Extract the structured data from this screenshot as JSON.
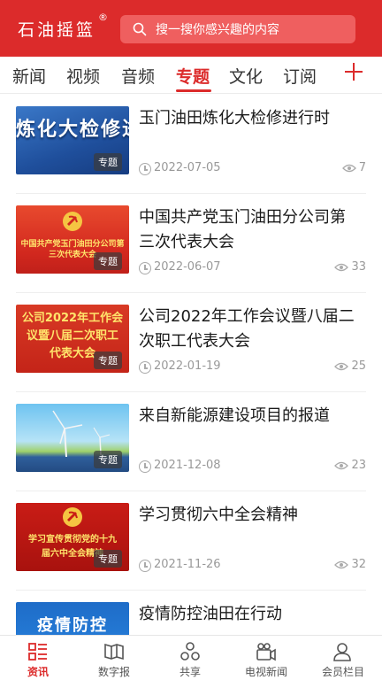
{
  "header": {
    "brand": "石油摇篮",
    "brand_mark": "®",
    "search_placeholder": "搜一搜你感兴趣的内容"
  },
  "tabs": [
    {
      "label": "新闻",
      "active": false
    },
    {
      "label": "视频",
      "active": false
    },
    {
      "label": "音频",
      "active": false
    },
    {
      "label": "专题",
      "active": true
    },
    {
      "label": "文化",
      "active": false
    },
    {
      "label": "订阅",
      "active": false
    }
  ],
  "list": [
    {
      "title": "玉门油田炼化大检修进行时",
      "date": "2022-07-05",
      "views": "7",
      "badge": "专题",
      "thumb_text": "炼化大检修进行时"
    },
    {
      "title": "中国共产党玉门油田分公司第三次代表大会",
      "date": "2022-06-07",
      "views": "33",
      "badge": "专题",
      "thumb_text": "中国共产党玉门油田分公司第三次代表大会"
    },
    {
      "title": "公司2022年工作会议暨八届二次职工代表大会",
      "date": "2022-01-19",
      "views": "25",
      "badge": "专题",
      "thumb_text": "公司2022年工作会议暨八届二次职工代表大会"
    },
    {
      "title": "来自新能源建设项目的报道",
      "date": "2021-12-08",
      "views": "23",
      "badge": "专题"
    },
    {
      "title": "学习贯彻六中全会精神",
      "date": "2021-11-26",
      "views": "32",
      "badge": "专题",
      "thumb_text": "学习宣传贯彻党的十九届六中全会精神"
    },
    {
      "title": "疫情防控油田在行动",
      "thumb_text": "疫情防控"
    }
  ],
  "bottom_nav": [
    {
      "label": "资讯",
      "icon": "news-list-icon",
      "active": true
    },
    {
      "label": "数字报",
      "icon": "newspaper-icon",
      "active": false
    },
    {
      "label": "共享",
      "icon": "share-circles-icon",
      "active": false
    },
    {
      "label": "电视新闻",
      "icon": "video-camera-icon",
      "active": false
    },
    {
      "label": "会员栏目",
      "icon": "user-icon",
      "active": false
    }
  ],
  "colors": {
    "brand_red": "#dc2b2b",
    "text_muted": "#999999"
  }
}
